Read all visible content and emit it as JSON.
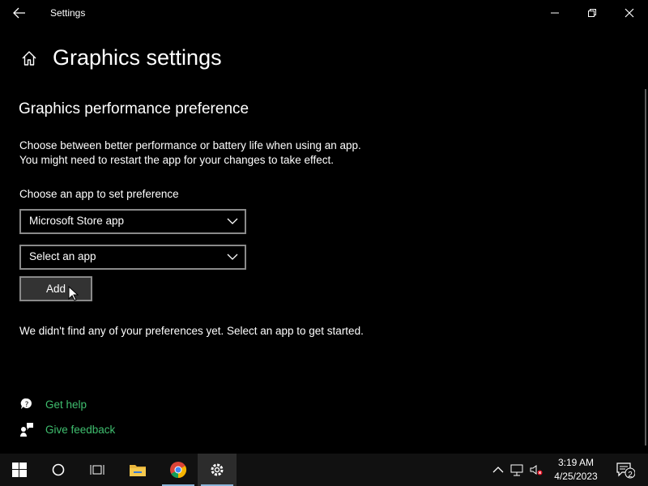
{
  "titlebar": {
    "app_name": "Settings",
    "icons": [
      "back-arrow-icon",
      "minimize-icon",
      "restore-icon",
      "close-icon"
    ]
  },
  "page": {
    "title": "Graphics settings",
    "home_icon": "home-icon"
  },
  "section": {
    "title": "Graphics performance preference",
    "description_line1": "Choose between better performance or battery life when using an app.",
    "description_line2": "You might need to restart the app for your changes to take effect.",
    "choose_label": "Choose an app to set preference",
    "app_type_select": {
      "value": "Microsoft Store app"
    },
    "app_select": {
      "value": "Select an app"
    },
    "add_button": "Add",
    "empty_notice": "We didn't find any of your preferences yet. Select an app to get started."
  },
  "help_links": [
    {
      "label": "Get help",
      "icon": "help-chat-icon"
    },
    {
      "label": "Give feedback",
      "icon": "feedback-icon"
    }
  ],
  "taskbar": {
    "apps": [
      "windows-start-icon",
      "cortana-circle-icon",
      "task-view-icon",
      "file-explorer-icon",
      "chrome-icon",
      "settings-gear-icon"
    ],
    "tray": [
      "chevron-up-icon",
      "network-icon",
      "volume-muted-icon"
    ],
    "time": "3:19 AM",
    "date": "4/25/2023",
    "notification_count": "2"
  },
  "colors": {
    "link": "#3fbf6f",
    "background": "#000000",
    "taskbar": "#111111"
  }
}
